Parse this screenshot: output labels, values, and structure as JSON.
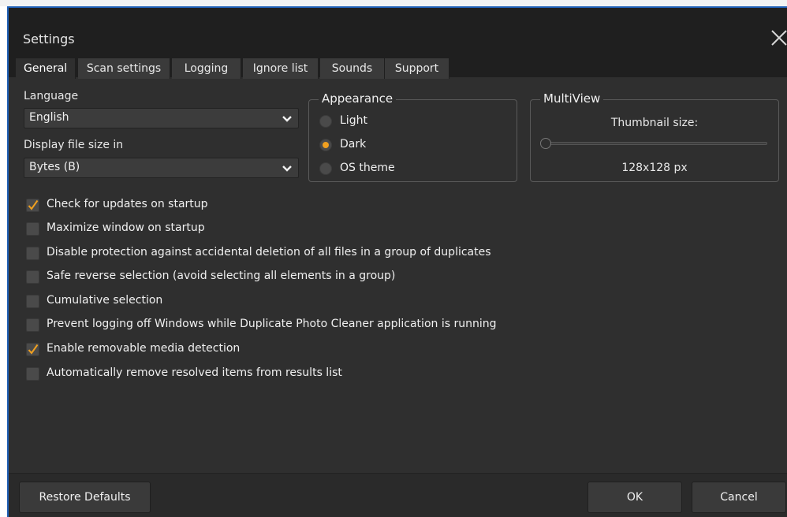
{
  "window": {
    "title": "Settings"
  },
  "tabs": [
    {
      "label": "General",
      "active": true
    },
    {
      "label": "Scan settings",
      "active": false
    },
    {
      "label": "Logging",
      "active": false
    },
    {
      "label": "Ignore list",
      "active": false
    },
    {
      "label": "Sounds",
      "active": false
    },
    {
      "label": "Support",
      "active": false
    }
  ],
  "language": {
    "label": "Language",
    "value": "English"
  },
  "filesize": {
    "label": "Display file size in",
    "value": "Bytes (B)"
  },
  "appearance": {
    "title": "Appearance",
    "options": [
      {
        "label": "Light",
        "checked": false
      },
      {
        "label": "Dark",
        "checked": true
      },
      {
        "label": "OS theme",
        "checked": false
      }
    ]
  },
  "multiview": {
    "title": "MultiView",
    "thumbnail_label": "Thumbnail size:",
    "thumbnail_value": "128x128 px",
    "slider_level": 0.0
  },
  "options": [
    {
      "label": "Check for updates on startup",
      "checked": true
    },
    {
      "label": "Maximize window on startup",
      "checked": false
    },
    {
      "label": "Disable protection against accidental deletion of all files in a group of duplicates",
      "checked": false
    },
    {
      "label": "Safe reverse selection (avoid selecting all elements in a group)",
      "checked": false
    },
    {
      "label": "Cumulative selection",
      "checked": false
    },
    {
      "label": "Prevent logging off Windows while Duplicate Photo Cleaner application is running",
      "checked": false
    },
    {
      "label": "Enable removable media detection",
      "checked": true
    },
    {
      "label": "Automatically remove resolved items from results list",
      "checked": false
    }
  ],
  "buttons": {
    "restore": "Restore Defaults",
    "ok": "OK",
    "cancel": "Cancel"
  },
  "colors": {
    "accent": "#f0a020",
    "window_border": "#1f5fb4",
    "background": "#2f2f2f"
  },
  "icons": {
    "close": "close-icon",
    "dropdown": "chevron-down-icon",
    "check": "checkmark-icon"
  }
}
